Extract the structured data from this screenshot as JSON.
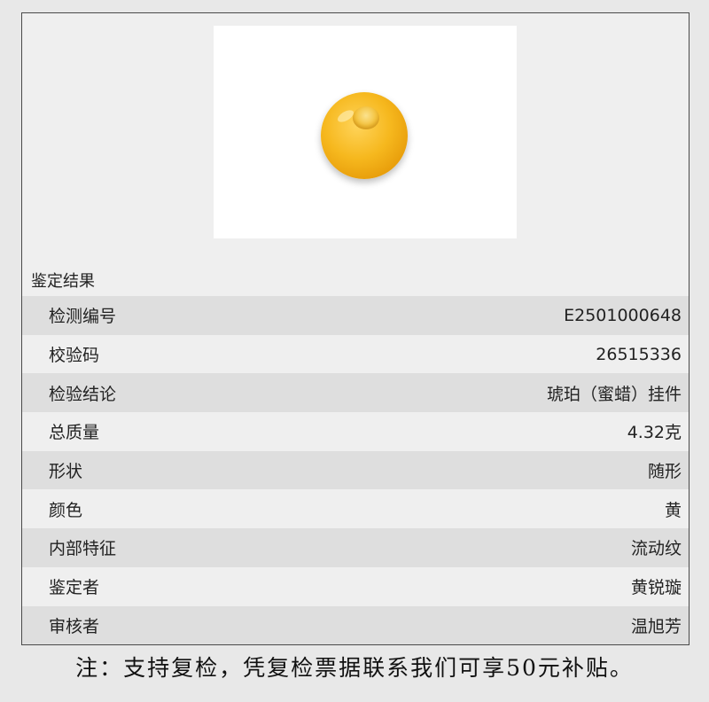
{
  "section_title": "鉴定结果",
  "photo": {
    "subject": "amber-bead"
  },
  "rows": [
    {
      "label": "检测编号",
      "value": "E2501000648"
    },
    {
      "label": "校验码",
      "value": "26515336"
    },
    {
      "label": "检验结论",
      "value": "琥珀（蜜蜡）挂件"
    },
    {
      "label": "总质量",
      "value": "4.32克"
    },
    {
      "label": "形状",
      "value": "随形"
    },
    {
      "label": "颜色",
      "value": "黄"
    },
    {
      "label": "内部特征",
      "value": "流动纹"
    },
    {
      "label": "鉴定者",
      "value": "黄锐璇"
    },
    {
      "label": "审核者",
      "value": "温旭芳"
    }
  ],
  "footer_note": "注：支持复检，凭复检票据联系我们可享50元补贴。"
}
